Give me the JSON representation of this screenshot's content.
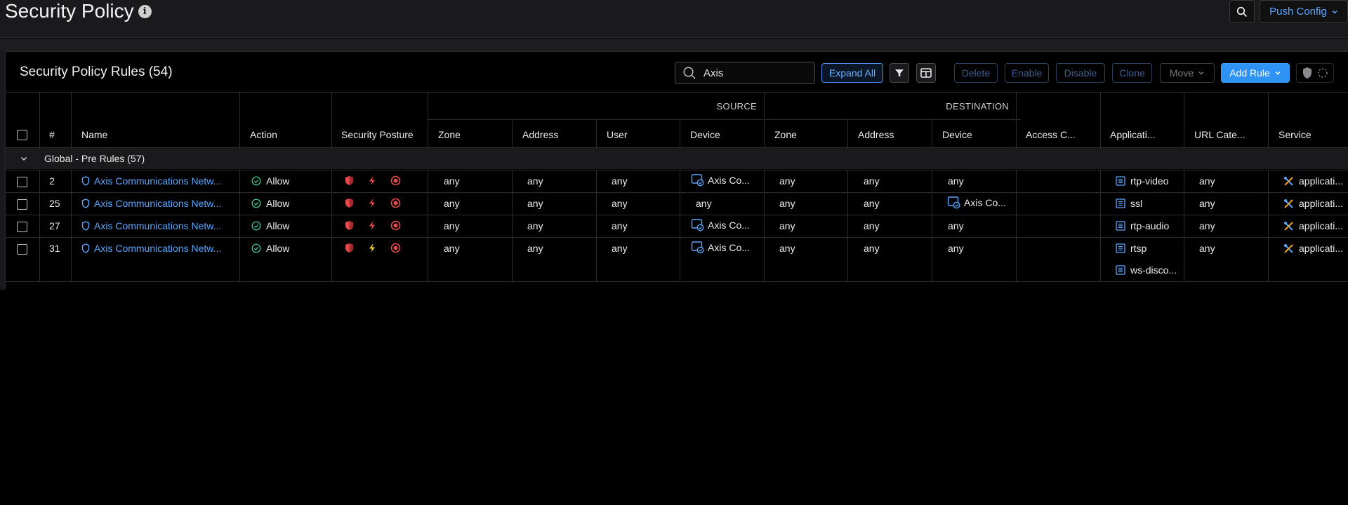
{
  "page": {
    "title": "Security Policy"
  },
  "top": {
    "push_config_label": "Push Config"
  },
  "panel": {
    "title": "Security Policy Rules (54)",
    "search_value": "Axis",
    "expand_all_label": "Expand All",
    "delete_label": "Delete",
    "enable_label": "Enable",
    "disable_label": "Disable",
    "clone_label": "Clone",
    "move_label": "Move",
    "add_rule_label": "Add Rule"
  },
  "table": {
    "group_headers": {
      "source": "SOURCE",
      "destination": "DESTINATION"
    },
    "columns": {
      "num": "#",
      "name": "Name",
      "action": "Action",
      "posture": "Security Posture",
      "src_zone": "Zone",
      "src_address": "Address",
      "src_user": "User",
      "src_device": "Device",
      "dst_zone": "Zone",
      "dst_address": "Address",
      "dst_device": "Device",
      "access": "Access C...",
      "application": "Applicati...",
      "url": "URL Cate...",
      "service": "Service"
    },
    "group_label": "Global - Pre Rules (57)",
    "rows": [
      {
        "num": "2",
        "name": "Axis Communications Netw...",
        "action": "Allow",
        "src_zone": "any",
        "src_address": "any",
        "src_user": "any",
        "src_device": "Axis Co...",
        "dst_zone": "any",
        "dst_address": "any",
        "dst_device": "any",
        "apps": [
          "rtp-video"
        ],
        "url": "any",
        "service": "applicati..."
      },
      {
        "num": "25",
        "name": "Axis Communications Netw...",
        "action": "Allow",
        "src_zone": "any",
        "src_address": "any",
        "src_user": "any",
        "src_device": "any",
        "dst_zone": "any",
        "dst_address": "any",
        "dst_device": "Axis Co...",
        "apps": [
          "ssl"
        ],
        "url": "any",
        "service": "applicati..."
      },
      {
        "num": "27",
        "name": "Axis Communications Netw...",
        "action": "Allow",
        "src_zone": "any",
        "src_address": "any",
        "src_user": "any",
        "src_device": "Axis Co...",
        "dst_zone": "any",
        "dst_address": "any",
        "dst_device": "any",
        "apps": [
          "rtp-audio"
        ],
        "url": "any",
        "service": "applicati..."
      },
      {
        "num": "31",
        "name": "Axis Communications Netw...",
        "action": "Allow",
        "src_zone": "any",
        "src_address": "any",
        "src_user": "any",
        "src_device": "Axis Co...",
        "dst_zone": "any",
        "dst_address": "any",
        "dst_device": "any",
        "apps": [
          "rtsp",
          "ws-disco..."
        ],
        "url": "any",
        "service": "applicati..."
      }
    ]
  },
  "colors": {
    "accent": "#5aa7ff",
    "danger": "#e5484d",
    "warning": "#f2d33a",
    "success": "#3fb68b"
  }
}
